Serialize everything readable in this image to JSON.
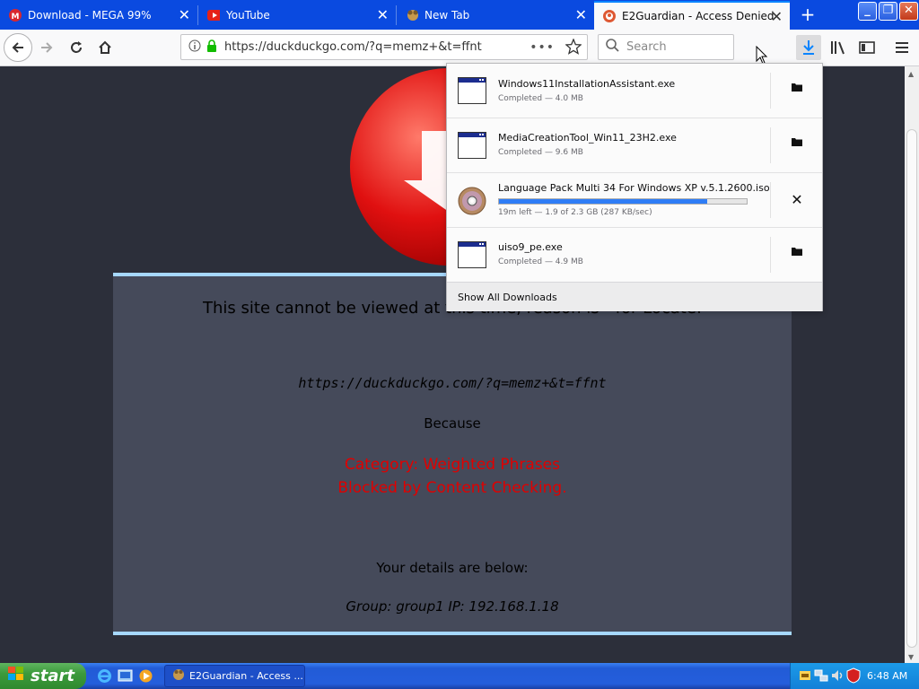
{
  "browser": {
    "tabs": [
      {
        "title": "Download - MEGA 99%",
        "icon": "mega-icon"
      },
      {
        "title": "YouTube",
        "icon": "youtube-icon"
      },
      {
        "title": "New Tab",
        "icon": "newtab-icon"
      },
      {
        "title": "E2Guardian - Access Denied",
        "icon": "duckduckgo-icon",
        "selected": true
      }
    ],
    "url": "https://duckduckgo.com/?q=memz+&t=ffnt",
    "search_placeholder": "Search"
  },
  "page": {
    "title_text": "This site cannot be viewed at this time, reason is - for Locate:",
    "blocked_url": "https://duckduckgo.com/?q=memz+&t=ffnt",
    "because": "Because",
    "category": "Category: Weighted Phrases",
    "blocked_by": "Blocked by Content Checking.",
    "details_heading": "Your details are below:",
    "group_line": "Group: group1   IP: 192.168.1.18"
  },
  "downloads": {
    "items": [
      {
        "name": "Windows11InstallationAssistant.exe",
        "status": "Completed — 4.0 MB",
        "icon": "exe-window-icon",
        "action": "folder-icon"
      },
      {
        "name": "MediaCreationTool_Win11_23H2.exe",
        "status": "Completed — 9.6 MB",
        "icon": "exe-window-icon",
        "action": "folder-icon"
      },
      {
        "name": "Language Pack Multi 34 For Windows XP v.5.1.2600.iso",
        "status": "19m left — 1.9 of 2.3 GB (287 KB/sec)",
        "icon": "disc-icon",
        "action": "cancel-icon",
        "progress": 0.84
      },
      {
        "name": "uiso9_pe.exe",
        "status": "Completed — 4.9 MB",
        "icon": "exe-window-icon",
        "action": "folder-icon"
      }
    ],
    "show_all": "Show All Downloads"
  },
  "taskbar": {
    "start": "start",
    "task": "E2Guardian - Access ...",
    "clock": "6:48 AM"
  },
  "colors": {
    "tab_strip": "#0a4ae0",
    "panel_bg": "#454a5a",
    "panel_border": "#a6d8ff",
    "block_red": "#e00000",
    "progress": "#2f7df6"
  }
}
